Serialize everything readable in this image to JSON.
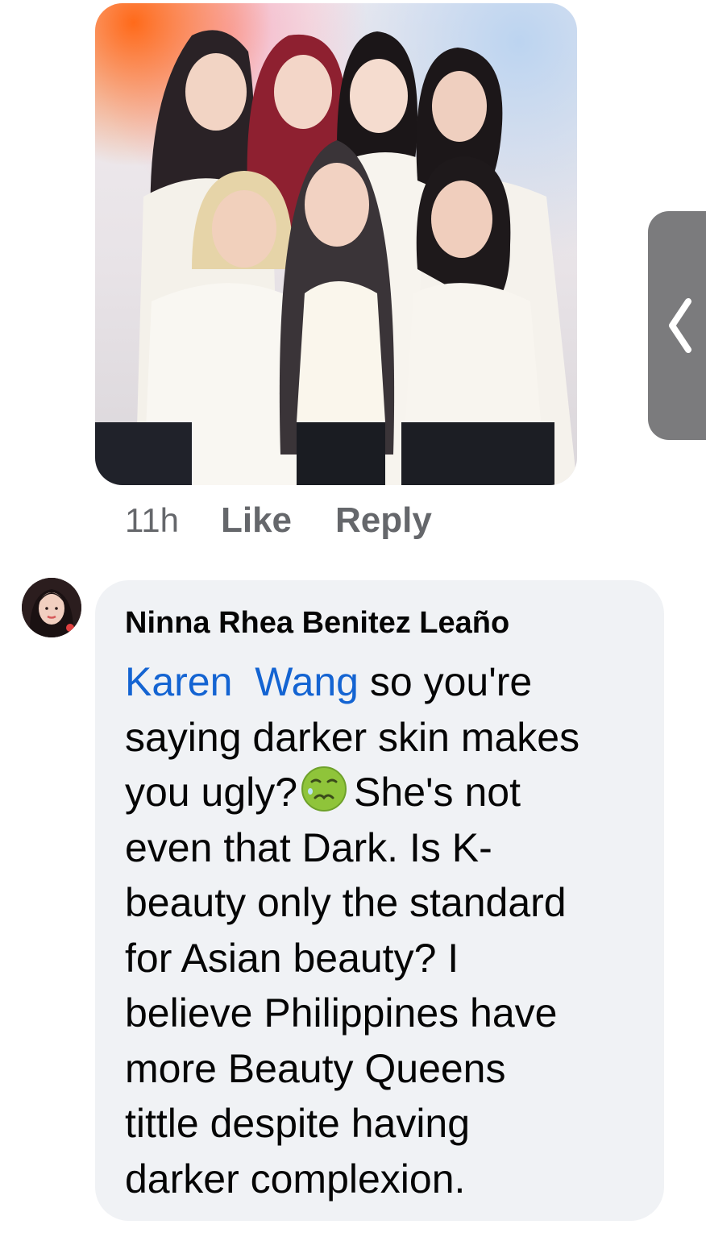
{
  "post_image": {
    "alt": "Group photo of seven women in white outfits",
    "colors": {
      "corner_glow": "#ff6a1a",
      "background": "#ebe6ea"
    }
  },
  "actions": {
    "time": "11h",
    "like_label": "Like",
    "reply_label": "Reply"
  },
  "side_handle": {
    "icon": "chevron-left-icon"
  },
  "comment": {
    "avatar_icon": "profile-photo",
    "author": "Ninna Rhea Benitez Leaño",
    "mentions": [
      "Karen",
      "Wang"
    ],
    "line1_text": " so you're",
    "line2": "saying darker skin makes",
    "line3_before_emoji": "you ugly?",
    "emoji": "nauseated-face-emoji",
    "line3_after_emoji": "She's not",
    "line4": "even that Dark. Is K-",
    "line5": "beauty only the standard",
    "line6": "for Asian beauty? I",
    "line7": "believe Philippines have",
    "line8": "more Beauty Queens",
    "line9": "tittle despite having",
    "line10": "darker complexion."
  },
  "colors": {
    "link_blue": "#1464d2",
    "secondary_text": "#65676b",
    "bubble_bg": "#f0f2f5",
    "handle_gray": "#7b7b7d"
  }
}
